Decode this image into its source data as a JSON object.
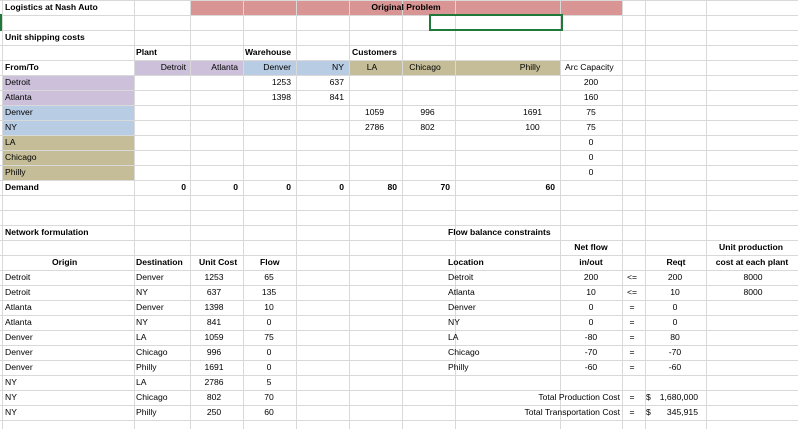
{
  "sheet": {
    "title": "Logistics at Nash Auto",
    "banner": "Original Problem",
    "colors": {
      "banner": "#d99594",
      "plant": "#ccc0da",
      "warehouse": "#b8cce4",
      "customer": "#c4bd97",
      "grid": "#d9d9d9",
      "selection": "#1f7a3a"
    }
  },
  "costs": {
    "section_label": "Unit shipping costs",
    "group_plant": "Plant",
    "group_warehouse": "Warehouse",
    "group_customers": "Customers",
    "from_to": "From/To",
    "headers": [
      "Detroit",
      "Atlanta",
      "Denver",
      "NY",
      "LA",
      "Chicago",
      "Philly"
    ],
    "arc_capacity_label": "Arc Capacity",
    "rows": [
      {
        "name": "Detroit",
        "cells": [
          "",
          "",
          "1253",
          "637",
          "",
          "",
          ""
        ],
        "cap": "200"
      },
      {
        "name": "Atlanta",
        "cells": [
          "",
          "",
          "1398",
          "841",
          "",
          "",
          ""
        ],
        "cap": "160"
      },
      {
        "name": "Denver",
        "cells": [
          "",
          "",
          "",
          "",
          "1059",
          "996",
          "1691"
        ],
        "cap": "75"
      },
      {
        "name": "NY",
        "cells": [
          "",
          "",
          "",
          "",
          "2786",
          "802",
          "100"
        ],
        "cap": "75"
      },
      {
        "name": "LA",
        "cells": [
          "",
          "",
          "",
          "",
          "",
          "",
          ""
        ],
        "cap": "0"
      },
      {
        "name": "Chicago",
        "cells": [
          "",
          "",
          "",
          "",
          "",
          "",
          ""
        ],
        "cap": "0"
      },
      {
        "name": "Philly",
        "cells": [
          "",
          "",
          "",
          "",
          "",
          "",
          ""
        ],
        "cap": "0"
      }
    ],
    "demand_label": "Demand",
    "demand": [
      "0",
      "0",
      "0",
      "0",
      "80",
      "70",
      "60"
    ]
  },
  "network": {
    "section_label": "Network formulation",
    "col_origin": "Origin",
    "col_destination": "Destination",
    "col_unit_cost": "Unit Cost",
    "col_flow": "Flow",
    "rows": [
      {
        "origin": "Detroit",
        "dest": "Denver",
        "cost": "1253",
        "flow": "65"
      },
      {
        "origin": "Detroit",
        "dest": "NY",
        "cost": "637",
        "flow": "135"
      },
      {
        "origin": "Atlanta",
        "dest": "Denver",
        "cost": "1398",
        "flow": "10"
      },
      {
        "origin": "Atlanta",
        "dest": "NY",
        "cost": "841",
        "flow": "0"
      },
      {
        "origin": "Denver",
        "dest": "LA",
        "cost": "1059",
        "flow": "75"
      },
      {
        "origin": "Denver",
        "dest": "Chicago",
        "cost": "996",
        "flow": "0"
      },
      {
        "origin": "Denver",
        "dest": "Philly",
        "cost": "1691",
        "flow": "0"
      },
      {
        "origin": "NY",
        "dest": "LA",
        "cost": "2786",
        "flow": "5"
      },
      {
        "origin": "NY",
        "dest": "Chicago",
        "cost": "802",
        "flow": "70"
      },
      {
        "origin": "NY",
        "dest": "Philly",
        "cost": "250",
        "flow": "60"
      }
    ]
  },
  "balance": {
    "section_label": "Flow balance constraints",
    "net_flow_1": "Net flow",
    "net_flow_2": "in/out",
    "col_location": "Location",
    "col_reqt": "Reqt",
    "prod_cost_1": "Unit production",
    "prod_cost_2": "cost at each plant",
    "rows": [
      {
        "loc": "Detroit",
        "net": "200",
        "op": "<=",
        "reqt": "200",
        "prod": "8000"
      },
      {
        "loc": "Atlanta",
        "net": "10",
        "op": "<=",
        "reqt": "10",
        "prod": "8000"
      },
      {
        "loc": "Denver",
        "net": "0",
        "op": "=",
        "reqt": "0",
        "prod": ""
      },
      {
        "loc": "NY",
        "net": "0",
        "op": "=",
        "reqt": "0",
        "prod": ""
      },
      {
        "loc": "LA",
        "net": "-80",
        "op": "=",
        "reqt": "80",
        "prod": ""
      },
      {
        "loc": "Chicago",
        "net": "-70",
        "op": "=",
        "reqt": "-70",
        "prod": ""
      },
      {
        "loc": "Philly",
        "net": "-60",
        "op": "=",
        "reqt": "-60",
        "prod": ""
      }
    ],
    "total_production_label": "Total Production Cost",
    "total_production_eq": "=",
    "total_production_cur": "$",
    "total_production_value": "1,680,000",
    "total_transport_label": "Total Transportation Cost",
    "total_transport_eq": "=",
    "total_transport_cur": "$",
    "total_transport_value": "345,915"
  }
}
